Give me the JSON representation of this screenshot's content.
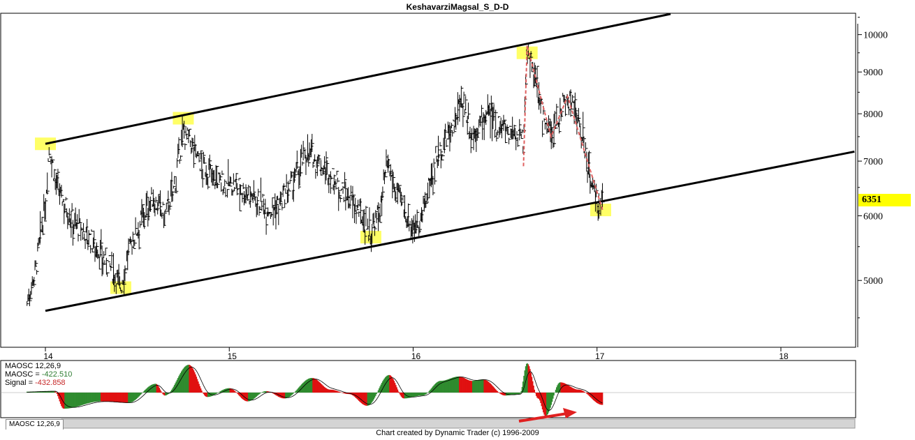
{
  "title": "KeshavarziMagsal_S_D-D",
  "footer": "Chart created by Dynamic Trader  (c) 1996-2009",
  "tab_label": "MAOSC 12,26,9",
  "last_price": "6351",
  "oscillator": {
    "name": "MAOSC 12,26,9",
    "maosc_label": "MAOSC =",
    "maosc_value": "-422.510",
    "signal_label": "Signal =",
    "signal_value": "-432.858"
  },
  "colors": {
    "bars": "#000000",
    "highlight": "#ffff66",
    "channel": "#000000",
    "pattern": "#e06060",
    "osc_up": "#2e8b2e",
    "osc_down": "#e01010",
    "arrow": "#e02020"
  },
  "chart_data": {
    "type": "bar",
    "title": "KeshavarziMagsal_S_D-D",
    "y_scale": "log",
    "ylim": [
      4150,
      10600
    ],
    "xlim": [
      13.9,
      18.45
    ],
    "x_ticks": [
      14,
      15,
      16,
      17,
      18
    ],
    "y_ticks": [
      5000,
      6000,
      7000,
      8000,
      9000,
      10000
    ],
    "price_path": [
      [
        13.9,
        4700
      ],
      [
        13.95,
        5200
      ],
      [
        14.0,
        6200
      ],
      [
        14.02,
        7300
      ],
      [
        14.06,
        6500
      ],
      [
        14.15,
        5900
      ],
      [
        14.25,
        5600
      ],
      [
        14.32,
        5300
      ],
      [
        14.38,
        5100
      ],
      [
        14.41,
        4900
      ],
      [
        14.45,
        5400
      ],
      [
        14.5,
        5800
      ],
      [
        14.58,
        6300
      ],
      [
        14.65,
        6000
      ],
      [
        14.7,
        6500
      ],
      [
        14.75,
        7600
      ],
      [
        14.8,
        7300
      ],
      [
        14.85,
        6900
      ],
      [
        14.95,
        6600
      ],
      [
        15.05,
        6500
      ],
      [
        15.15,
        6300
      ],
      [
        15.22,
        6100
      ],
      [
        15.28,
        6200
      ],
      [
        15.35,
        6600
      ],
      [
        15.42,
        7200
      ],
      [
        15.5,
        6900
      ],
      [
        15.58,
        6600
      ],
      [
        15.65,
        6300
      ],
      [
        15.72,
        6000
      ],
      [
        15.77,
        5700
      ],
      [
        15.82,
        6100
      ],
      [
        15.86,
        6900
      ],
      [
        15.9,
        6500
      ],
      [
        15.95,
        6100
      ],
      [
        16.0,
        5800
      ],
      [
        16.05,
        6000
      ],
      [
        16.12,
        7000
      ],
      [
        16.2,
        7600
      ],
      [
        16.27,
        8300
      ],
      [
        16.32,
        7500
      ],
      [
        16.4,
        8000
      ],
      [
        16.48,
        7700
      ],
      [
        16.55,
        7600
      ],
      [
        16.6,
        7400
      ],
      [
        16.62,
        9700
      ],
      [
        16.66,
        8800
      ],
      [
        16.72,
        7700
      ],
      [
        16.76,
        7500
      ],
      [
        16.8,
        8100
      ],
      [
        16.84,
        8400
      ],
      [
        16.88,
        8100
      ],
      [
        16.93,
        7300
      ],
      [
        16.97,
        6600
      ],
      [
        17.0,
        6100
      ],
      [
        17.03,
        6351
      ]
    ],
    "channel_lines": [
      {
        "name": "upper",
        "x": [
          14.0,
          17.4
        ],
        "y": [
          7350,
          10600
        ]
      },
      {
        "name": "lower",
        "x": [
          14.0,
          18.4
        ],
        "y": [
          4590,
          7190
        ]
      }
    ],
    "pattern_points": {
      "x": [
        16.6,
        16.62,
        16.75,
        16.84,
        17.03
      ],
      "y": [
        6900,
        9700,
        7500,
        8400,
        6100
      ]
    },
    "highlighted_points": [
      {
        "x": 14.0,
        "y": 7350
      },
      {
        "x": 14.41,
        "y": 4900
      },
      {
        "x": 14.75,
        "y": 7900
      },
      {
        "x": 15.77,
        "y": 5650
      },
      {
        "x": 16.62,
        "y": 9500
      },
      {
        "x": 17.02,
        "y": 6100
      }
    ],
    "oscillator": {
      "name": "MAOSC 12,26,9",
      "last_maosc": -422.51,
      "last_signal": -432.858,
      "ylim": [
        -1000,
        1000
      ],
      "peaks": [
        [
          13.9,
          30
        ],
        [
          14.05,
          50
        ],
        [
          14.1,
          -550
        ],
        [
          14.3,
          -300
        ],
        [
          14.45,
          -350
        ],
        [
          14.6,
          300
        ],
        [
          14.65,
          -100
        ],
        [
          14.78,
          950
        ],
        [
          14.88,
          -150
        ],
        [
          15.0,
          150
        ],
        [
          15.1,
          -300
        ],
        [
          15.2,
          50
        ],
        [
          15.3,
          -200
        ],
        [
          15.45,
          500
        ],
        [
          15.55,
          100
        ],
        [
          15.65,
          -50
        ],
        [
          15.75,
          -450
        ],
        [
          15.87,
          600
        ],
        [
          15.95,
          -200
        ],
        [
          16.05,
          -100
        ],
        [
          16.15,
          400
        ],
        [
          16.25,
          550
        ],
        [
          16.32,
          400
        ],
        [
          16.38,
          450
        ],
        [
          16.5,
          -100
        ],
        [
          16.58,
          -50
        ],
        [
          16.62,
          1000
        ],
        [
          16.68,
          -200
        ],
        [
          16.72,
          -800
        ],
        [
          16.8,
          350
        ],
        [
          16.9,
          100
        ],
        [
          17.03,
          -420
        ]
      ]
    }
  }
}
